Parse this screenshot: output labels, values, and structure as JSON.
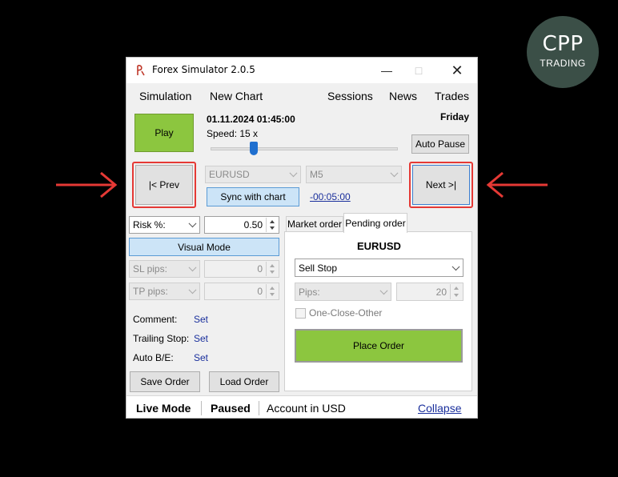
{
  "logo": {
    "line1": "CPP",
    "line2": "TRADING"
  },
  "window": {
    "title": "Forex Simulator 2.0.5"
  },
  "menu": {
    "simulation": "Simulation",
    "new_chart": "New Chart",
    "sessions": "Sessions",
    "news": "News",
    "trades": "Trades"
  },
  "top": {
    "play_label": "Play",
    "datetime": "01.11.2024 01:45:00",
    "weekday": "Friday",
    "speed": "Speed: 15 x",
    "auto_pause_label": "Auto Pause",
    "prev_label": "|< Prev",
    "next_label": "Next >|",
    "symbol": "EURUSD",
    "timeframe": "M5",
    "sync_label": "Sync with chart",
    "offset": "-00:05:00"
  },
  "left": {
    "risk_label": "Risk %:",
    "risk_value": "0.50",
    "visual_mode_label": "Visual Mode",
    "sl_label": "SL pips:",
    "sl_value": "0",
    "tp_label": "TP pips:",
    "tp_value": "0",
    "comment_label": "Comment:",
    "comment_link": "Set",
    "trailing_label": "Trailing Stop:",
    "trailing_link": "Set",
    "autobe_label": "Auto B/E:",
    "autobe_link": "Set",
    "save_label": "Save Order",
    "load_label": "Load Order"
  },
  "right": {
    "tab_market": "Market order",
    "tab_pending": "Pending order",
    "symbol": "EURUSD",
    "order_type": "Sell Stop",
    "pips_label": "Pips:",
    "pips_value": "20",
    "oco_label": "One-Close-Other",
    "place_label": "Place Order"
  },
  "status": {
    "mode": "Live Mode",
    "state": "Paused",
    "account": "Account in USD",
    "collapse": "Collapse"
  },
  "colors": {
    "green": "#8cc63f",
    "highlight": "#e53935",
    "link": "#1a2f9c",
    "slider": "#1f6fcf"
  }
}
